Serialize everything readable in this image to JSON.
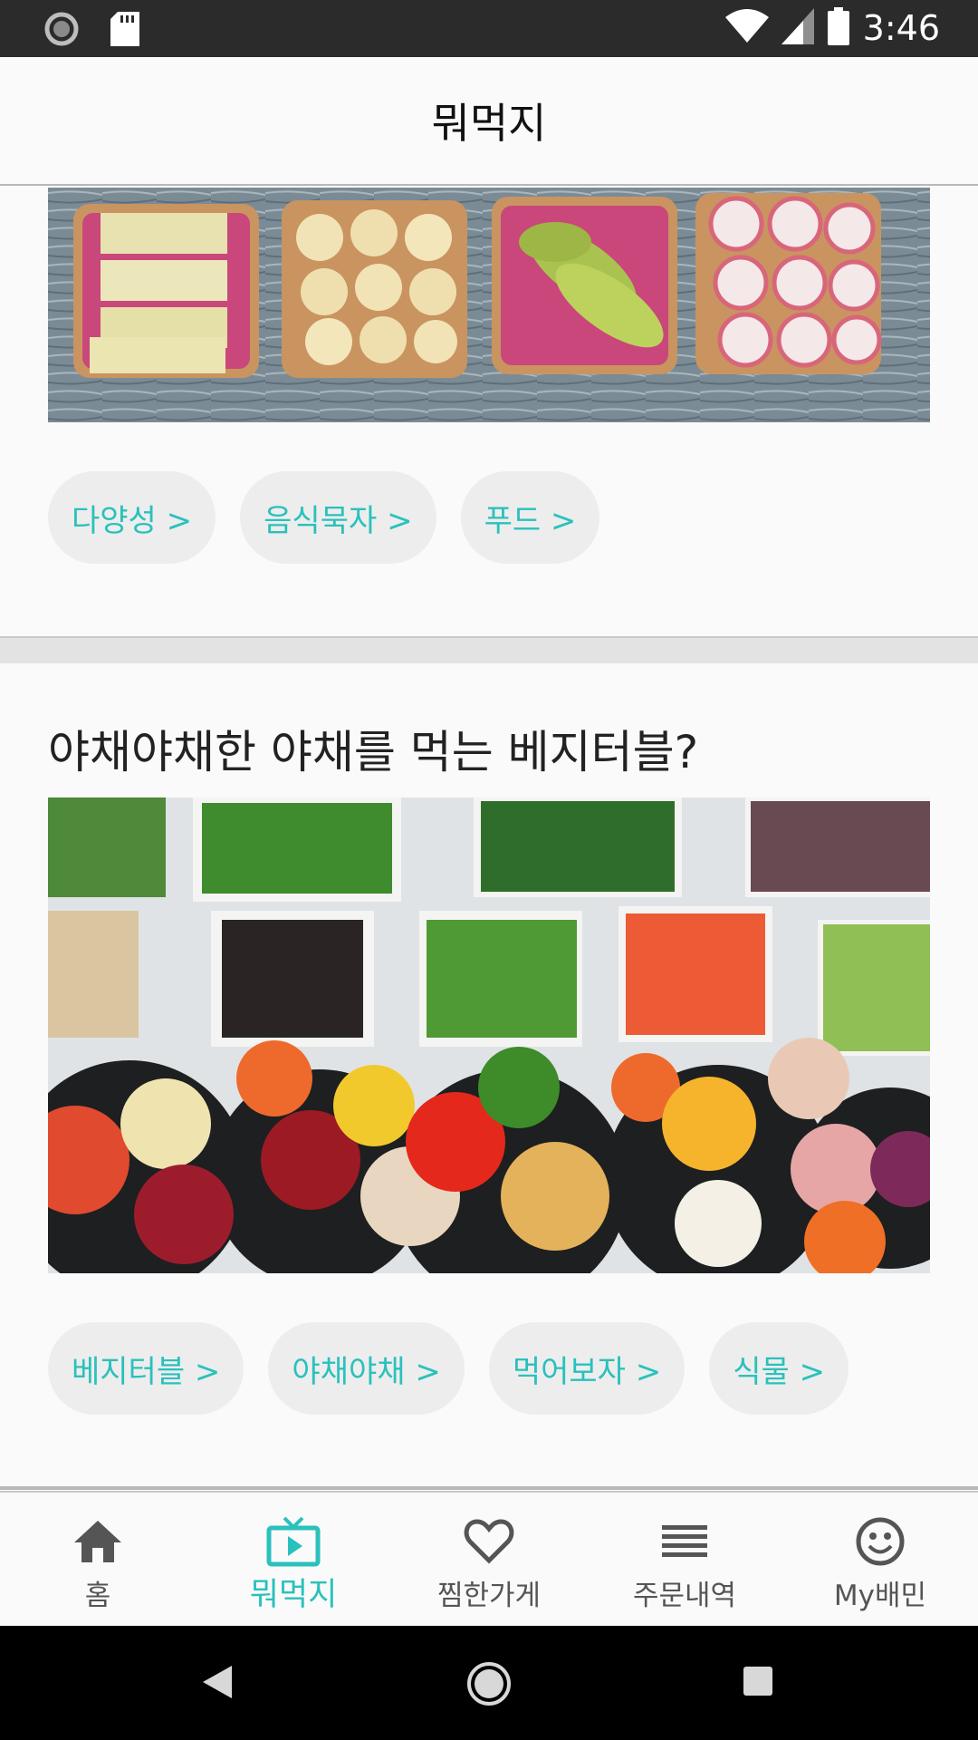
{
  "status_bar": {
    "time": "3:46",
    "icons": [
      "sync-icon",
      "sd-card-icon",
      "wifi-icon",
      "signal-icon",
      "battery-icon"
    ]
  },
  "app_bar": {
    "title": "뭐먹지"
  },
  "sections": [
    {
      "image_alt": "toast-with-toppings-photo",
      "tags": [
        "다양성 >",
        "음식묵자 >",
        "푸드 >"
      ]
    },
    {
      "title": "야채야채한 야채를 먹는 베지터블?",
      "image_alt": "salad-bar-vegetables-photo",
      "tags": [
        "베지터블 >",
        "야채야채 >",
        "먹어보자 >",
        "식물 >"
      ]
    }
  ],
  "bottom_nav": {
    "items": [
      {
        "label": "홈",
        "icon": "home-icon",
        "active": false
      },
      {
        "label": "뭐먹지",
        "icon": "tv-play-icon",
        "active": true
      },
      {
        "label": "찜한가게",
        "icon": "heart-icon",
        "active": false
      },
      {
        "label": "주문내역",
        "icon": "list-icon",
        "active": false
      },
      {
        "label": "My배민",
        "icon": "smiley-icon",
        "active": false
      }
    ]
  },
  "colors": {
    "accent": "#2ac1bc",
    "chip_background": "#ededed",
    "status_bar": "#2b2b2b"
  }
}
